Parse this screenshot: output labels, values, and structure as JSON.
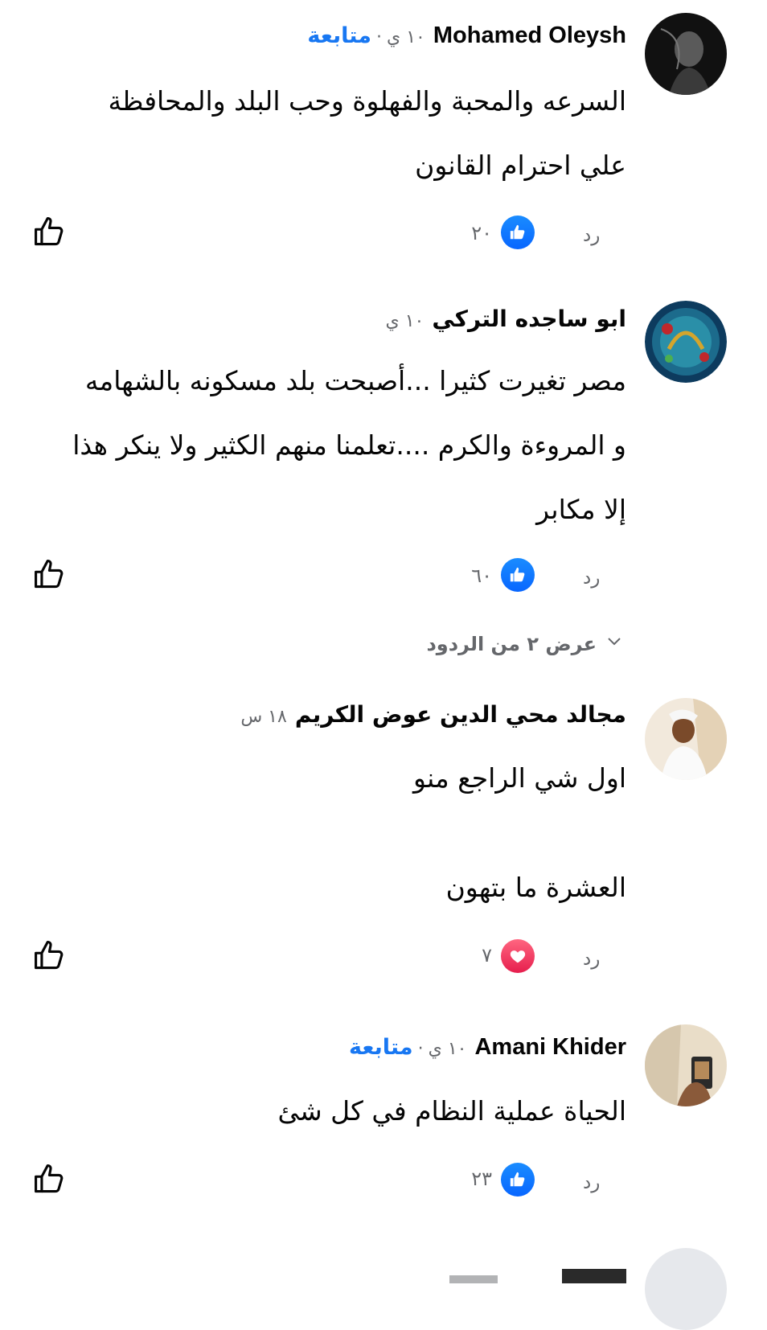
{
  "comments": [
    {
      "name": "Mohamed Oleysh",
      "time": "١٠ ي",
      "follow": "متابعة",
      "body": [
        "السرعه والمحبة والفهلوة وحب البلد والمحافظة",
        "علي احترام القانون"
      ],
      "reaction_count": "٢٠",
      "reaction_type": "like",
      "reply": "رد"
    },
    {
      "name": "ابو ساجده التركي",
      "time": "١٠ ي",
      "body": [
        "مصر تغيرت كثيرا ...أصبحت بلد مسكونه بالشهامه",
        "و المروءة والكرم ....تعلمنا منهم الكثير ولا ينكر هذا",
        "إلا مكابر"
      ],
      "reaction_count": "٦٠",
      "reaction_type": "like",
      "reply": "رد"
    },
    {
      "name": "مجالد محي الدين عوض الكريم",
      "time": "١٨ س",
      "body": [
        "اول شي الراجع منو",
        "",
        "العشرة ما بتهون"
      ],
      "reaction_count": "٧",
      "reaction_type": "love",
      "reply": "رد"
    },
    {
      "name": "Amani Khider",
      "time": "١٠ ي",
      "follow": "متابعة",
      "body": [
        "الحياة عملية النظام في كل شئ"
      ],
      "reaction_count": "٢٣",
      "reaction_type": "like",
      "reply": "رد"
    }
  ],
  "view_replies": "عرض ٢ من الردود",
  "colors": {
    "accent": "#1877f2",
    "muted": "#65676b",
    "love": "#e61e4d"
  }
}
